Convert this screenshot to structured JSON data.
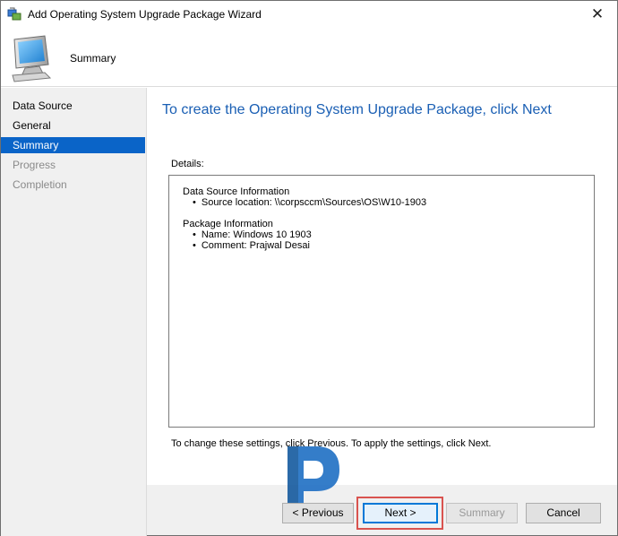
{
  "window": {
    "title": "Add Operating System Upgrade Package Wizard",
    "close_glyph": "✕"
  },
  "header": {
    "title": "Summary"
  },
  "nav": {
    "items": [
      {
        "label": "Data Source",
        "state": "normal"
      },
      {
        "label": "General",
        "state": "normal"
      },
      {
        "label": "Summary",
        "state": "selected"
      },
      {
        "label": "Progress",
        "state": "disabled"
      },
      {
        "label": "Completion",
        "state": "disabled"
      }
    ]
  },
  "content": {
    "title": "To create the Operating System Upgrade Package, click Next",
    "details_label": "Details:",
    "details": {
      "section1_title": "Data Source Information",
      "section1_item1": "Source location: \\\\corpsccm\\Sources\\OS\\W10-1903",
      "section2_title": "Package Information",
      "section2_item1": "Name: Windows 10 1903",
      "section2_item2": "Comment: Prajwal Desai"
    },
    "hint": "To change these settings, click Previous. To apply the settings, click Next."
  },
  "buttons": {
    "previous": "< Previous",
    "next": "Next >",
    "summary": "Summary",
    "cancel": "Cancel"
  },
  "colors": {
    "accent": "#0a64c8",
    "title_blue": "#1a5fb4",
    "highlight_red": "#d9534f"
  },
  "icons": {
    "title": "wizard-app-icon",
    "header": "computer-monitor-icon",
    "logo": "prajwal-desai-logo"
  }
}
